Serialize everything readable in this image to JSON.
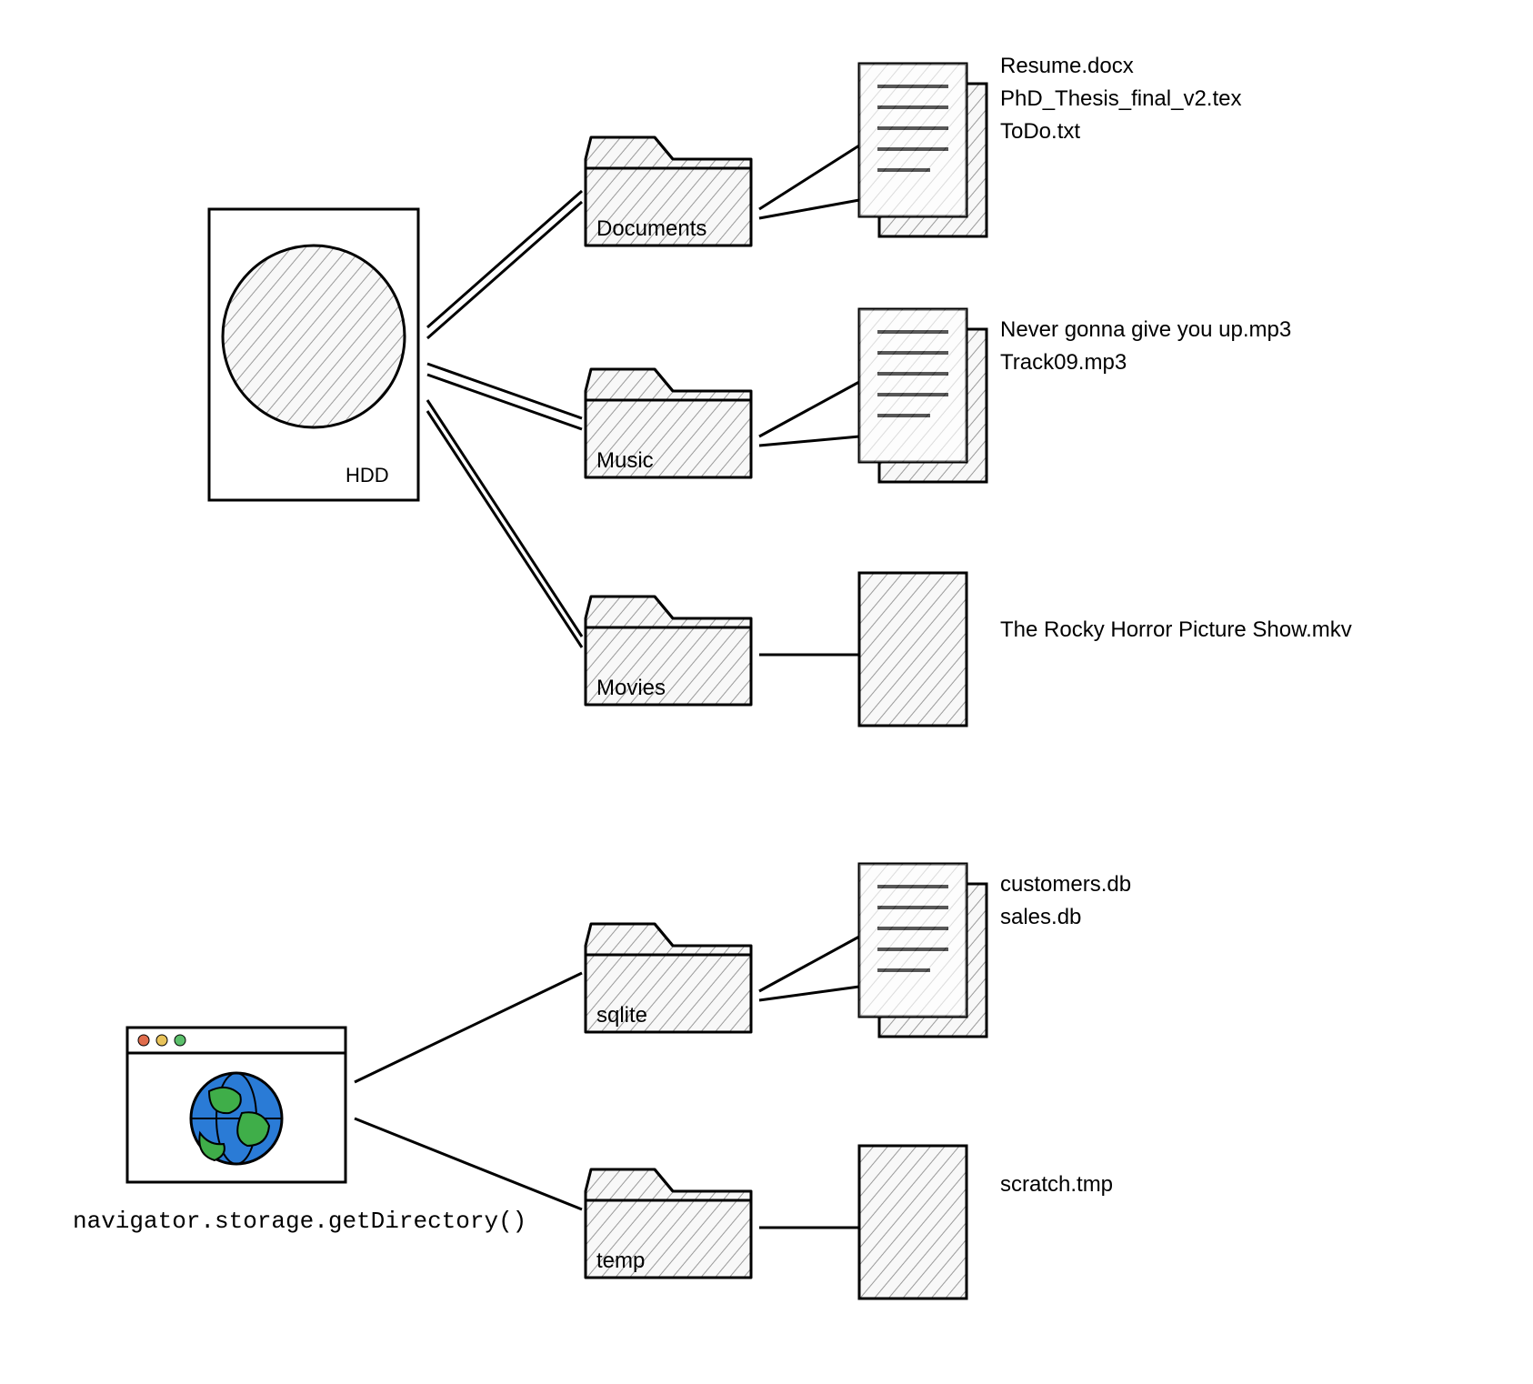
{
  "hdd": {
    "label": "HDD",
    "folders": [
      {
        "name": "Documents",
        "files": [
          "Resume.docx",
          "PhD_Thesis_final_v2.tex",
          "ToDo.txt"
        ]
      },
      {
        "name": "Music",
        "files": [
          "Never gonna give you up.mp3",
          "Track09.mp3"
        ]
      },
      {
        "name": "Movies",
        "files": [
          "The Rocky Horror Picture Show.mkv"
        ]
      }
    ]
  },
  "browser": {
    "api_call": "navigator.storage.getDirectory()",
    "folders": [
      {
        "name": "sqlite",
        "files": [
          "customers.db",
          "sales.db"
        ]
      },
      {
        "name": "temp",
        "files": [
          "scratch.tmp"
        ]
      }
    ]
  }
}
